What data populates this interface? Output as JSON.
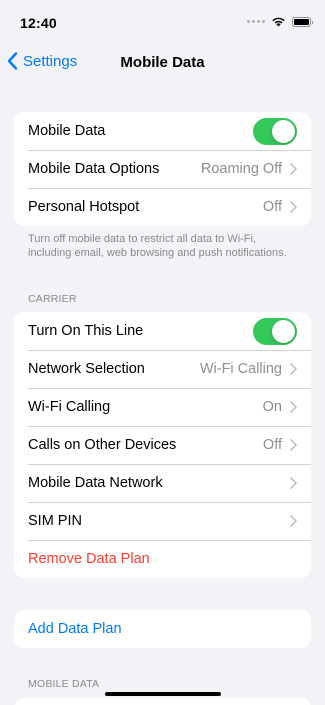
{
  "status": {
    "time": "12:40"
  },
  "nav": {
    "back_label": "Settings",
    "title": "Mobile Data"
  },
  "group1": {
    "rows": [
      {
        "label": "Mobile Data",
        "toggle_on": true
      },
      {
        "label": "Mobile Data Options",
        "value": "Roaming Off"
      },
      {
        "label": "Personal Hotspot",
        "value": "Off"
      }
    ],
    "footnote": "Turn off mobile data to restrict all data to Wi-Fi, including email, web browsing and push notifications."
  },
  "carrier": {
    "header": "CARRIER",
    "rows": [
      {
        "label": "Turn On This Line",
        "toggle_on": true
      },
      {
        "label": "Network Selection",
        "value": "Wi-Fi Calling"
      },
      {
        "label": "Wi-Fi Calling",
        "value": "On"
      },
      {
        "label": "Calls on Other Devices",
        "value": "Off"
      },
      {
        "label": "Mobile Data Network"
      },
      {
        "label": "SIM PIN"
      },
      {
        "label": "Remove Data Plan"
      }
    ]
  },
  "add_plan": {
    "label": "Add Data Plan"
  },
  "mobile_data_section": {
    "header": "MOBILE DATA"
  },
  "colors": {
    "accent": "#007aff",
    "toggle_on": "#34c759",
    "destructive": "#ff3b30",
    "background": "#f2f2f7"
  }
}
